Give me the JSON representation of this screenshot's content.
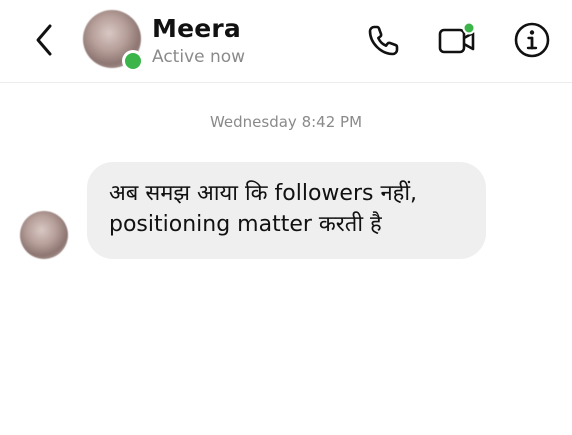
{
  "header": {
    "contact_name": "Meera",
    "status": "Active now",
    "icons": {
      "back": "chevron-left-icon",
      "call": "phone-icon",
      "video": "video-camera-icon",
      "info": "info-icon"
    },
    "online_color": "#3bb54a"
  },
  "conversation": {
    "timestamp": "Wednesday 8:42 PM",
    "messages": [
      {
        "sender": "Meera",
        "text": "अब समझ आया कि followers नहीं, positioning matter करती है"
      }
    ]
  },
  "colors": {
    "bubble_incoming": "#efefef",
    "text_primary": "#111111",
    "text_secondary": "#8a8a8a"
  }
}
